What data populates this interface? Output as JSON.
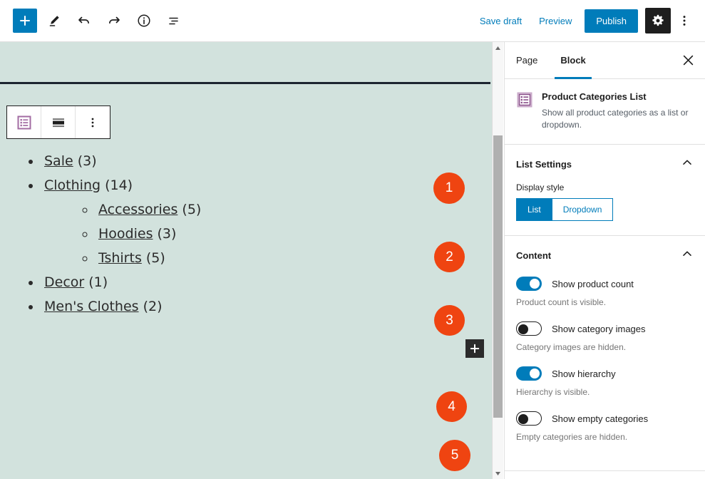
{
  "topbar": {
    "add_block_label": "+",
    "icons": [
      "edit-pencil-icon",
      "undo-icon",
      "redo-icon",
      "info-icon",
      "list-view-icon"
    ],
    "save_draft_label": "Save draft",
    "preview_label": "Preview",
    "publish_label": "Publish",
    "settings_icon": "gear-icon",
    "more_icon": "kebab-menu-icon"
  },
  "canvas": {
    "block_toolbar": {
      "block_type_icon": "product-categories-list-icon",
      "align_icon": "align-full-width-icon",
      "options_icon": "kebab-menu-icon"
    },
    "categories": [
      {
        "name": "Sale",
        "count": "(3)",
        "level": 1
      },
      {
        "name": "Clothing",
        "count": "(14)",
        "level": 1
      },
      {
        "name": "Accessories",
        "count": "(5)",
        "level": 2
      },
      {
        "name": "Hoodies",
        "count": "(3)",
        "level": 2
      },
      {
        "name": "Tshirts",
        "count": "(5)",
        "level": 2
      },
      {
        "name": "Decor",
        "count": "(1)",
        "level": 1
      },
      {
        "name": "Men's Clothes",
        "count": "(2)",
        "level": 1
      }
    ],
    "markers": [
      "1",
      "2",
      "3",
      "4",
      "5"
    ],
    "inserter_label": "+",
    "marker_color": "#ef4411",
    "background_color": "#d2e2dd"
  },
  "sidebar": {
    "tabs": [
      {
        "label": "Page",
        "active": false
      },
      {
        "label": "Block",
        "active": true
      }
    ],
    "close_icon": "close-icon",
    "block": {
      "icon": "product-categories-list-icon",
      "title": "Product Categories List",
      "description": "Show all product categories as a list or dropdown."
    },
    "panels": [
      {
        "title": "List Settings",
        "field_label": "Display style",
        "options": [
          {
            "label": "List",
            "selected": true
          },
          {
            "label": "Dropdown",
            "selected": false
          }
        ]
      },
      {
        "title": "Content",
        "toggles": [
          {
            "label": "Show product count",
            "on": true,
            "help": "Product count is visible."
          },
          {
            "label": "Show category images",
            "on": false,
            "help": "Category images are hidden."
          },
          {
            "label": "Show hierarchy",
            "on": true,
            "help": "Hierarchy is visible."
          },
          {
            "label": "Show empty categories",
            "on": false,
            "help": "Empty categories are hidden."
          }
        ]
      }
    ],
    "accent_color": "#007cba"
  }
}
